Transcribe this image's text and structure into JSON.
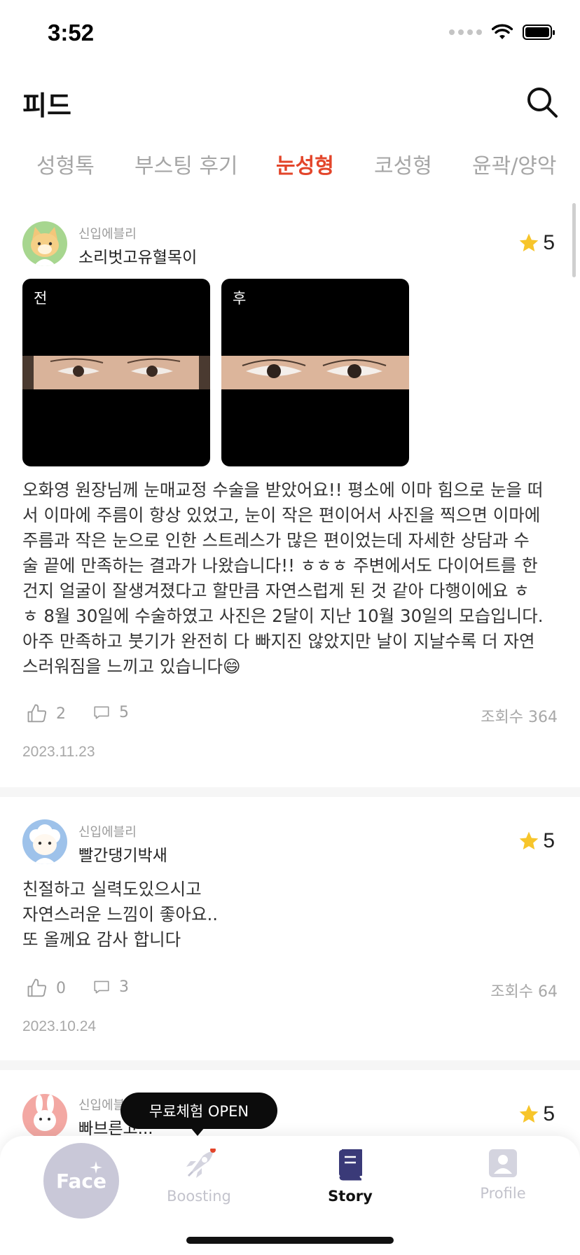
{
  "status": {
    "time": "3:52"
  },
  "header": {
    "title": "피드"
  },
  "tabs": [
    {
      "label": "성형톡",
      "active": false
    },
    {
      "label": "부스팅 후기",
      "active": false
    },
    {
      "label": "눈성형",
      "active": true
    },
    {
      "label": "코성형",
      "active": false
    },
    {
      "label": "윤곽/양악",
      "active": false
    }
  ],
  "posts": [
    {
      "rank": "신입에블리",
      "username": "소리벗고유혈목이",
      "rating": "5",
      "photos": [
        {
          "label": "전"
        },
        {
          "label": "후"
        }
      ],
      "body_lines": [
        "오화영 원장님께 눈매교정 수술을 받았어요!! 평소에 이마 힘으로 눈을 떠",
        "서 이마에 주름이 항상 있었고, 눈이 작은 편이어서 사진을 찍으면 이마에",
        "주름과 작은 눈으로 인한 스트레스가 많은 편이었는데 자세한 상담과 수",
        "술 끝에 만족하는 결과가 나왔습니다!! ㅎㅎㅎ 주변에서도 다이어트를 한",
        "건지 얼굴이 잘생겨졌다고 할만큼 자연스럽게 된 것 같아 다행이에요 ㅎ",
        "ㅎ 8월 30일에 수술하였고 사진은 2달이 지난 10월 30일의 모습입니다.",
        "아주 만족하고 붓기가 완전히 다 빠지진 않았지만 날이 지날수록 더 자연",
        "스러워짐을 느끼고 있습니다😄"
      ],
      "likes": "2",
      "comments": "5",
      "views": "조회수 364",
      "date": "2023.11.23"
    },
    {
      "rank": "신입에블리",
      "username": "빨간댕기박새",
      "rating": "5",
      "body_lines": [
        "친절하고 실력도있으시고",
        "자연스러운 느낌이 좋아요..",
        "또 올께요 감사 합니다"
      ],
      "likes": "0",
      "comments": "3",
      "views": "조회수 64",
      "date": "2023.10.24"
    },
    {
      "rank": "신입에블",
      "username": "빠브른고...",
      "rating": "5"
    }
  ],
  "tooltip": {
    "text": "무료체험 OPEN"
  },
  "tab_bar": {
    "face_label": "Face",
    "items": [
      {
        "label": "Boosting",
        "active": false
      },
      {
        "label": "Story",
        "active": true
      },
      {
        "label": "Profile",
        "active": false
      }
    ]
  },
  "colors": {
    "accent": "#e3452a",
    "inactive": "#a6a6a6",
    "star": "#f7c52b",
    "face_button": "#c9c8d8",
    "story_icon": "#3a3a78"
  }
}
